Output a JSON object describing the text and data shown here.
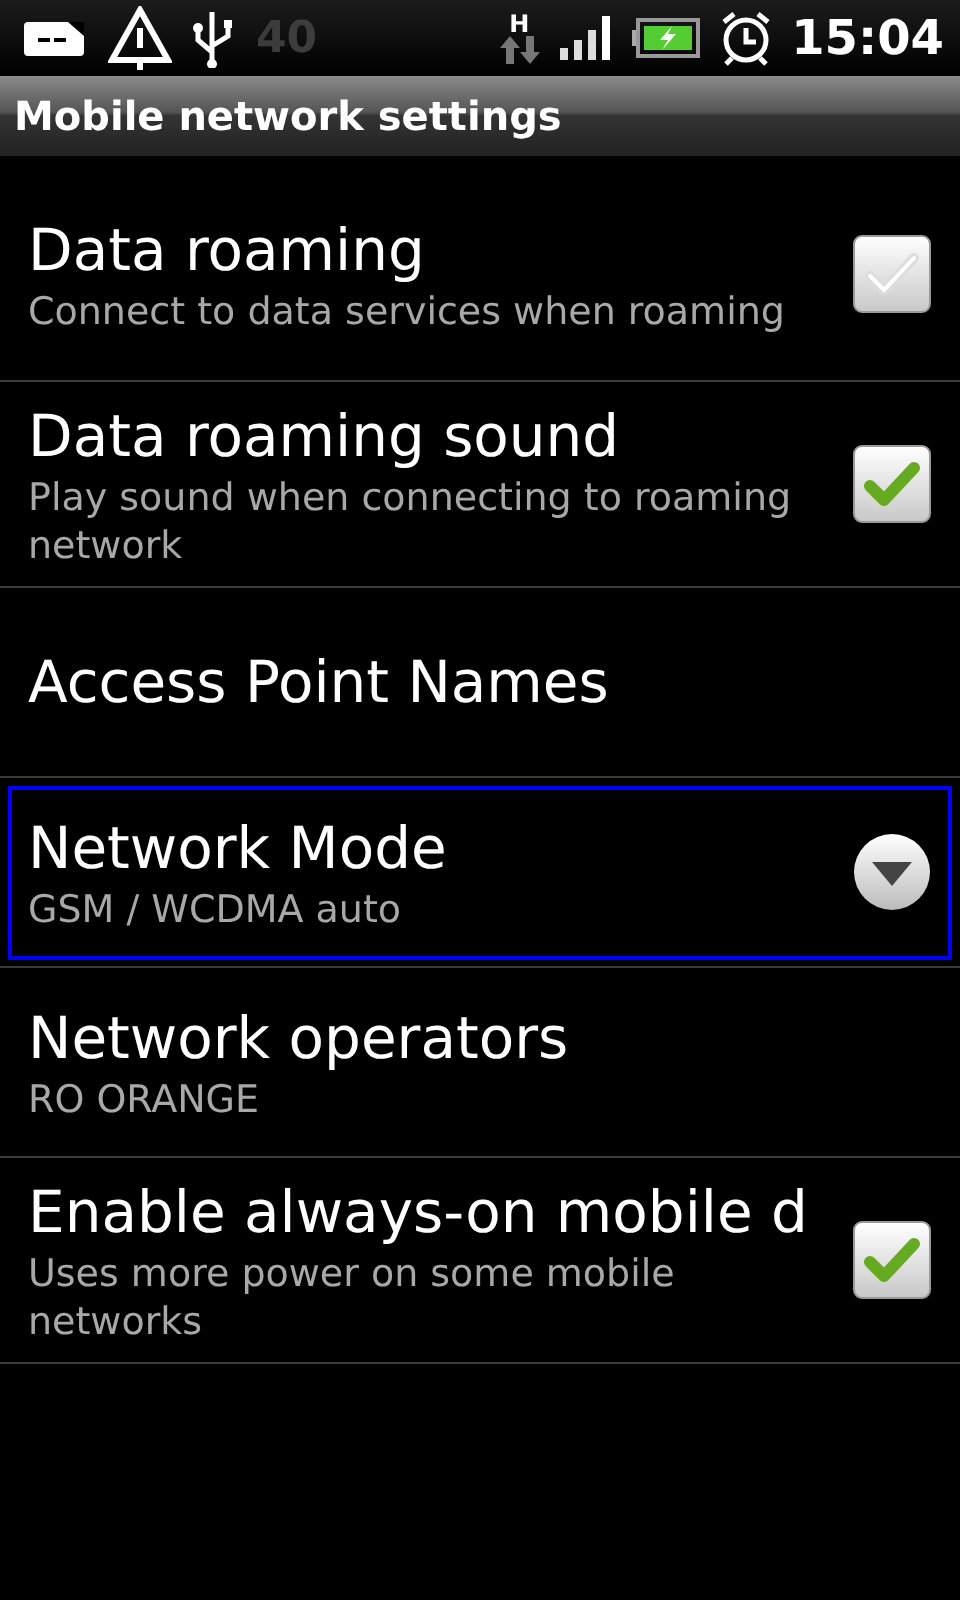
{
  "status_bar": {
    "battery_level_text": "40",
    "time": "15:04",
    "network_type": "H"
  },
  "window": {
    "title": "Mobile network settings"
  },
  "items": [
    {
      "kind": "checkbox",
      "title": "Data roaming",
      "summary": "Connect to data services when roaming",
      "checked": false,
      "focused": false
    },
    {
      "kind": "checkbox",
      "title": "Data roaming sound",
      "summary": "Play sound when connecting to roaming network",
      "checked": true,
      "focused": false
    },
    {
      "kind": "plain",
      "title": "Access Point Names",
      "focused": false
    },
    {
      "kind": "list",
      "title": "Network Mode",
      "summary": "GSM / WCDMA auto",
      "focused": true
    },
    {
      "kind": "plain",
      "title": "Network operators",
      "summary": "RO ORANGE",
      "focused": false
    },
    {
      "kind": "checkbox",
      "title": "Enable always-on mobile d",
      "summary": "Uses more power on some mobile networks",
      "checked": true,
      "focused": false
    }
  ]
}
